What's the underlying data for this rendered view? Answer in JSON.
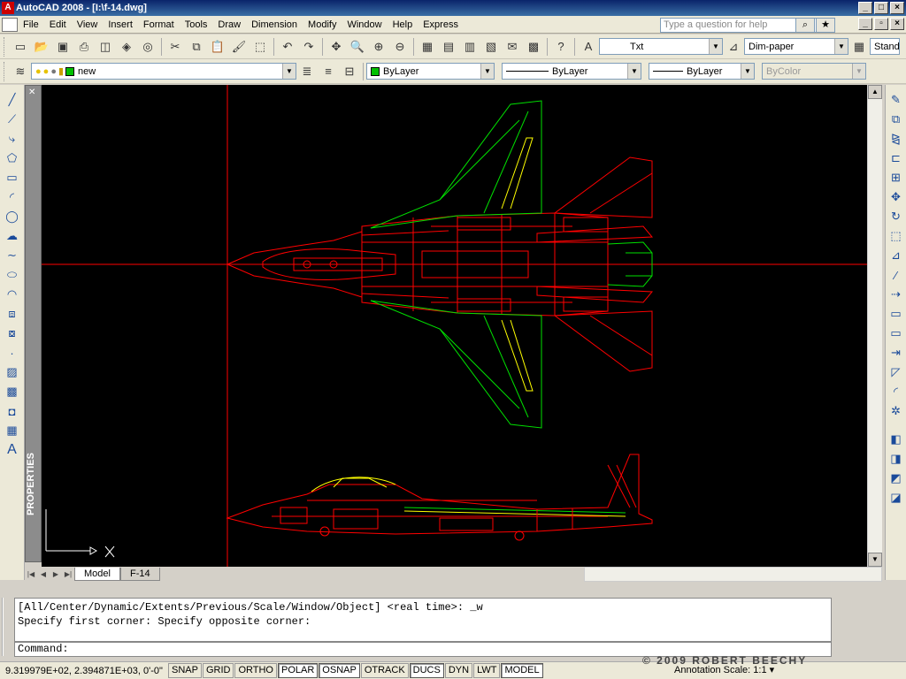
{
  "window": {
    "title": "AutoCAD 2008 - [I:\\f-14.dwg]",
    "app_icon": "autocad-icon"
  },
  "menu": {
    "items": [
      "File",
      "Edit",
      "View",
      "Insert",
      "Format",
      "Tools",
      "Draw",
      "Dimension",
      "Modify",
      "Window",
      "Help",
      "Express"
    ]
  },
  "help": {
    "placeholder": "Type a question for help"
  },
  "styles_toolbar": {
    "text_style": "Txt",
    "dim_style": "Dim-paper",
    "table_style": "Stand"
  },
  "layers_toolbar": {
    "current_layer": "new",
    "layer_color": "#00c000"
  },
  "properties_toolbar": {
    "color": "ByLayer",
    "color_swatch": "#00c000",
    "linetype": "ByLayer",
    "lineweight": "ByLayer",
    "plotstyle": "ByColor"
  },
  "properties_palette": {
    "label": "PROPERTIES"
  },
  "layout_tabs": {
    "model": "Model",
    "layout": "F-14"
  },
  "command": {
    "history_1": "[All/Center/Dynamic/Extents/Previous/Scale/Window/Object] <real time>: _w",
    "history_2": "Specify first corner: Specify opposite corner:",
    "prompt": "Command:"
  },
  "status": {
    "coordinates": "9.319979E+02, 2.394871E+03, 0'-0\"",
    "buttons": [
      "SNAP",
      "GRID",
      "ORTHO",
      "POLAR",
      "OSNAP",
      "OTRACK",
      "DUCS",
      "DYN",
      "LWT",
      "MODEL"
    ],
    "on": [
      "POLAR",
      "OSNAP",
      "DUCS",
      "MODEL"
    ],
    "annotation_scale_label": "Annotation Scale:",
    "annotation_scale": "1:1"
  },
  "watermark": "© 2009 ROBERT BEECHY",
  "drawing": {
    "crosshair_color": "#ff0000",
    "fuselage_color": "#ff0000",
    "wing_color": "#00e000",
    "highlight_color": "#ffff00"
  }
}
